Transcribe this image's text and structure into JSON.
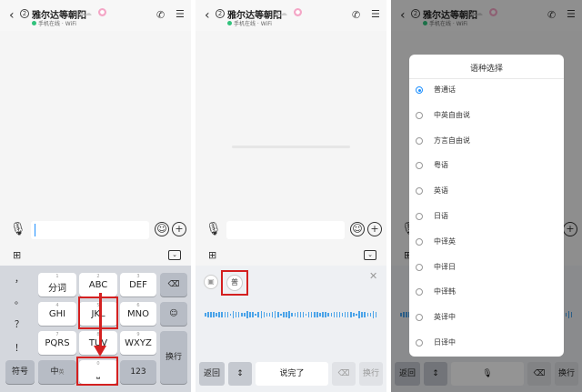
{
  "chat": {
    "title": "雅尔达等朝阳",
    "status": "手机在线 · WiFi",
    "back": "‹",
    "badge_count": "2"
  },
  "keyboard": {
    "punct": [
      "，",
      "。",
      "？",
      "！"
    ],
    "keys": [
      {
        "num": "1",
        "label": "分词"
      },
      {
        "num": "2",
        "label": "ABC"
      },
      {
        "num": "3",
        "label": "DEF"
      },
      {
        "num": "4",
        "label": "GHI"
      },
      {
        "num": "5",
        "label": "JKL"
      },
      {
        "num": "6",
        "label": "MNO"
      },
      {
        "num": "7",
        "label": "PQRS"
      },
      {
        "num": "8",
        "label": "TUV"
      },
      {
        "num": "9",
        "label": "WXYZ"
      }
    ],
    "symbol": "符号",
    "zh": "中",
    "zh_sub": "英",
    "space_num": "0",
    "num123": "123",
    "enter": "换行"
  },
  "voice": {
    "lang_short": "普",
    "back": "返回",
    "done": "说完了",
    "enter": "换行"
  },
  "dialog": {
    "title": "语种选择",
    "options": [
      "普通话",
      "中英自由说",
      "方言自由说",
      "粤语",
      "英语",
      "日语",
      "中译英",
      "中译日",
      "中译韩",
      "英译中",
      "日译中"
    ],
    "selected": "普通话"
  },
  "p3bar": {
    "back": "返回",
    "enter": "换行"
  },
  "colors": {
    "highlight": "#d42020",
    "accent": "#1e90ff",
    "wave": "#4aa3e8"
  }
}
